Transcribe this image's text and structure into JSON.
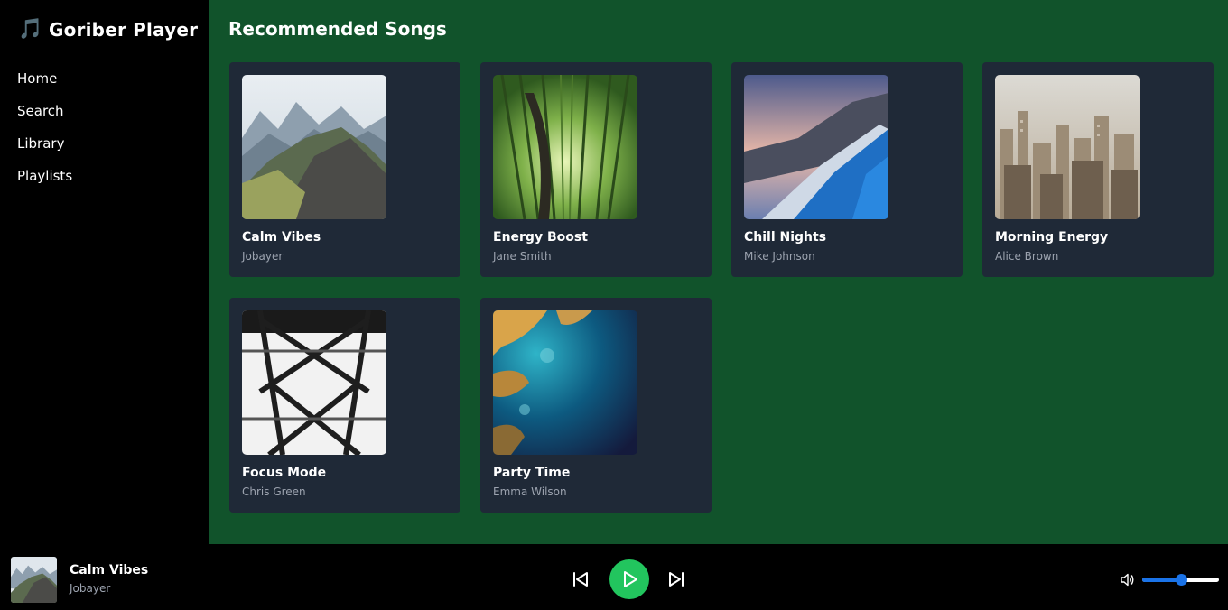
{
  "app": {
    "brand_icon": "🎵",
    "brand_name": "Goriber Player"
  },
  "sidebar": {
    "items": [
      {
        "label": "Home"
      },
      {
        "label": "Search"
      },
      {
        "label": "Library"
      },
      {
        "label": "Playlists"
      }
    ]
  },
  "main": {
    "title": "Recommended Songs",
    "songs": [
      {
        "title": "Calm Vibes",
        "artist": "Jobayer",
        "cover": "mountain-cover"
      },
      {
        "title": "Energy Boost",
        "artist": "Jane Smith",
        "cover": "bamboo-forest-cover"
      },
      {
        "title": "Chill Nights",
        "artist": "Mike Johnson",
        "cover": "road-dusk-cover"
      },
      {
        "title": "Morning Energy",
        "artist": "Alice Brown",
        "cover": "city-skyline-cover"
      },
      {
        "title": "Focus Mode",
        "artist": "Chris Green",
        "cover": "steel-tower-cover"
      },
      {
        "title": "Party Time",
        "artist": "Emma Wilson",
        "cover": "ocean-aerial-cover"
      }
    ]
  },
  "player": {
    "now_playing": {
      "title": "Calm Vibes",
      "artist": "Jobayer"
    },
    "controls": {
      "prev": "skip-back-icon",
      "play": "play-icon",
      "next": "skip-forward-icon"
    },
    "volume": {
      "icon": "volume-icon",
      "level": 0.5
    },
    "colors": {
      "play": "#22c55e",
      "slider": "#1a73e8"
    }
  },
  "colors": {
    "main_bg": "#11532b",
    "card_bg": "#1f2937",
    "sidebar_bg": "#000000"
  }
}
